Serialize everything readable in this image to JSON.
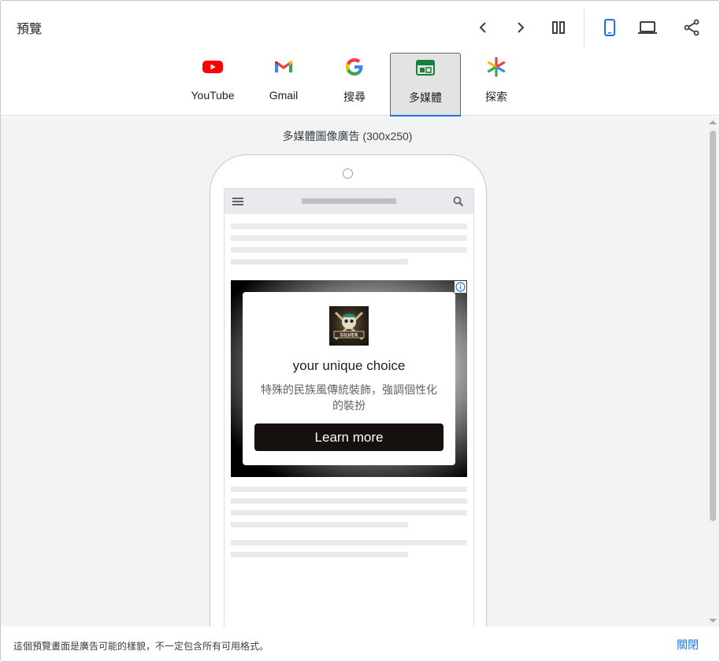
{
  "header": {
    "title": "預覽",
    "tabs": [
      {
        "label": "YouTube",
        "icon": "youtube-icon",
        "active": false
      },
      {
        "label": "Gmail",
        "icon": "gmail-icon",
        "active": false
      },
      {
        "label": "搜尋",
        "icon": "google-icon",
        "active": false
      },
      {
        "label": "多媒體",
        "icon": "display-icon",
        "active": true
      },
      {
        "label": "探索",
        "icon": "discover-icon",
        "active": false
      }
    ],
    "tools": [
      "chevron-left-icon",
      "chevron-right-icon",
      "split-view-icon",
      "mobile-icon",
      "desktop-icon",
      "share-icon"
    ]
  },
  "preview": {
    "caption": "多媒體圖像廣告 (300x250)"
  },
  "ad": {
    "logo_text": "SILVER",
    "headline": "your unique choice",
    "description": "特殊的民族風傳統裝飾，強調個性化的裝扮",
    "cta": "Learn more",
    "info_icon": "info-icon"
  },
  "footer": {
    "note": "這個預覽畫面是廣告可能的樣貌，不一定包含所有可用格式。",
    "close_label": "關閉"
  },
  "colors": {
    "accent": "#1a73e8",
    "cta_bg": "#16100e",
    "youtube_red": "#ff0000"
  }
}
